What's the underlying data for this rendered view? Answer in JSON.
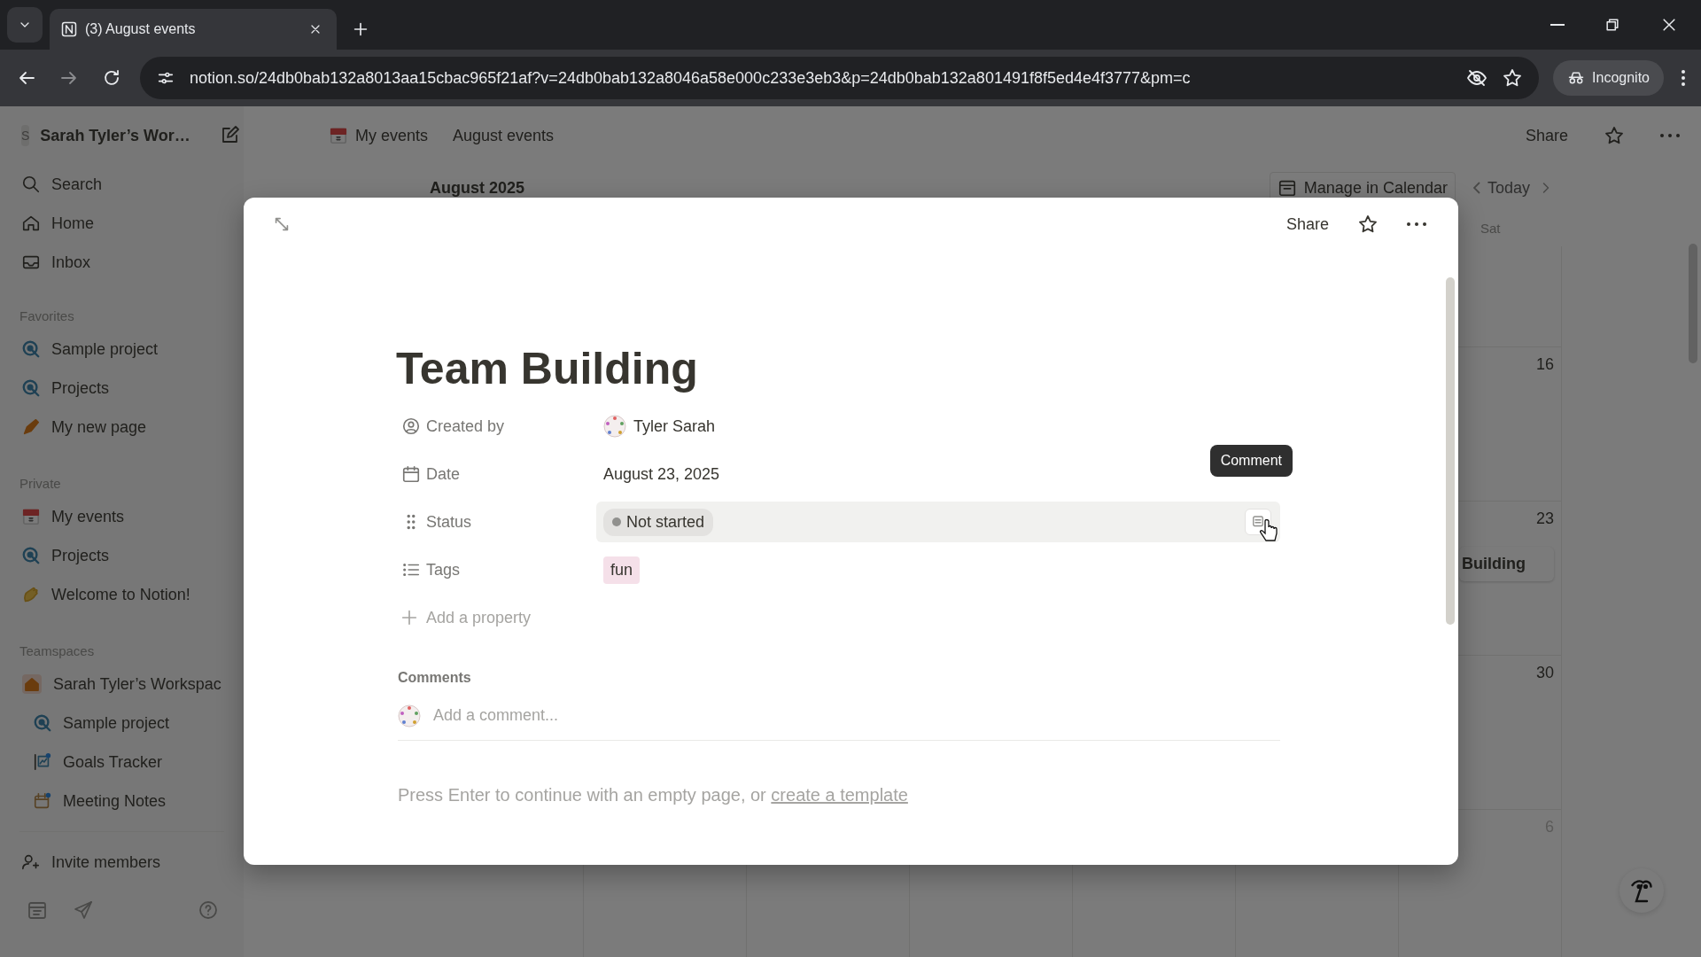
{
  "browser": {
    "tabs": [
      {
        "title": "(3) August events",
        "selected": true
      }
    ],
    "url": "notion.so/24db0bab132a8013aa15cbac965f21af?v=24db0bab132a8046a58e000c233e3eb3&p=24db0bab132a801491f8f5ed4e4f3777&pm=c",
    "profile": "Incognito"
  },
  "sidebar": {
    "workspace": {
      "initial": "S",
      "name": "Sarah Tyler’s Wor…"
    },
    "nav": [
      {
        "kind": "search",
        "label": "Search"
      },
      {
        "kind": "home",
        "label": "Home"
      },
      {
        "kind": "inbox",
        "label": "Inbox"
      }
    ],
    "sections": [
      {
        "title": "Favorites",
        "items": [
          {
            "kind": "target",
            "label": "Sample project"
          },
          {
            "kind": "target",
            "label": "Projects"
          },
          {
            "kind": "pencil",
            "label": "My new page"
          }
        ]
      },
      {
        "title": "Private",
        "items": [
          {
            "kind": "calendar",
            "label": "My events"
          },
          {
            "kind": "target",
            "label": "Projects"
          },
          {
            "kind": "wave",
            "label": "Welcome to Notion!"
          }
        ]
      },
      {
        "title": "Teamspaces",
        "items": [
          {
            "kind": "house",
            "label": "Sarah Tyler’s Workspac",
            "children": [
              {
                "kind": "target",
                "label": "Sample project"
              },
              {
                "kind": "goals",
                "label": "Goals Tracker"
              },
              {
                "kind": "meeting",
                "label": "Meeting Notes"
              }
            ]
          }
        ]
      }
    ],
    "footer": {
      "label": "Invite members"
    }
  },
  "topbar": {
    "breadcrumbs": [
      {
        "kind": "calendar",
        "label": "My events"
      },
      {
        "kind": "plain",
        "label": "August events"
      }
    ],
    "share": "Share"
  },
  "calendar": {
    "month": "August 2025",
    "manage": "Manage in Calendar",
    "today": "Today",
    "weekday": "Sat",
    "weeks": [
      {
        "day": "16",
        "other_month": false
      },
      {
        "day": "23",
        "other_month": false,
        "events": [
          "Building"
        ]
      },
      {
        "day": "30",
        "other_month": false
      },
      {
        "day": "6",
        "other_month": true
      }
    ]
  },
  "modal": {
    "share": "Share",
    "title": "Team Building",
    "properties": [
      {
        "kind": "person",
        "label": "Created by",
        "value": "Tyler Sarah",
        "hovered": false
      },
      {
        "kind": "date",
        "label": "Date",
        "value": "August 23, 2025",
        "hovered": false
      },
      {
        "kind": "status",
        "label": "Status",
        "value": "Not started",
        "hovered": true
      },
      {
        "kind": "tags",
        "label": "Tags",
        "tags": [
          "fun"
        ],
        "hovered": false
      }
    ],
    "tooltip": "Comment",
    "add_property": "Add a property",
    "comments": {
      "heading": "Comments",
      "placeholder": "Add a comment..."
    },
    "hint": {
      "text": "Press Enter to continue with an empty page, or ",
      "link": "create a template"
    }
  }
}
